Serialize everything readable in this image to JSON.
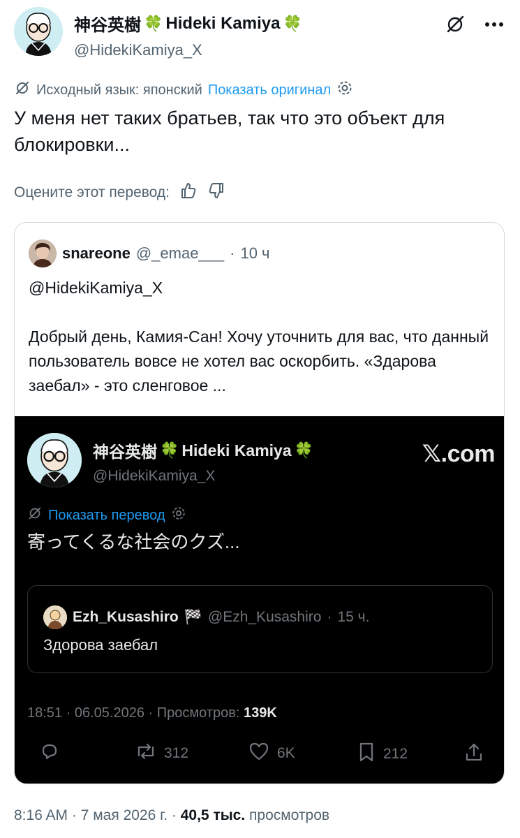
{
  "post": {
    "author_name": "神谷英樹",
    "author_name_latin": "Hideki Kamiya",
    "emoji": "🍀",
    "handle": "@HidekiKamiya_X",
    "translation_bar": {
      "source_lang": "Исходный язык: японский",
      "show_original": "Показать оригинал"
    },
    "text": "У меня нет таких братьев, так что это объект для блокировки...",
    "rate_label": "Оцените этот перевод:",
    "footer": {
      "time": "8:16 AM",
      "date": "7 мая 2026 г.",
      "views": "40,5 тыс.",
      "views_label": "просмотров"
    }
  },
  "quote": {
    "author_name": "snareone",
    "handle": "@_emae___",
    "age": "10 ч",
    "text": "@HidekiKamiya_X\n\nДобрый день, Камия-Сан! Хочу уточнить для вас, что данный пользователь вовсе не хотел вас оскорбить. «Здарова заебал» - это сленговое ..."
  },
  "screenshot": {
    "author_name": "神谷英樹",
    "author_name_latin": "Hideki Kamiya",
    "emoji": "🍀",
    "handle": "@HidekiKamiya_X",
    "brand": "𝕏.com",
    "show_translation": "Показать перевод",
    "text": "寄ってくるな社会のクズ...",
    "inner": {
      "author_name": "Ezh_Kusashiro",
      "flag": "🏁",
      "handle": "@Ezh_Kusashiro",
      "age": "15 ч.",
      "text": "Здорова заебал"
    },
    "stamp": {
      "time": "18:51",
      "date": "06.05.2026",
      "views_label": "Просмотров:",
      "views": "139K"
    },
    "actions": {
      "retweets": "312",
      "likes": "6K",
      "bookmarks": "212"
    }
  },
  "colors": {
    "accent": "#1d9bf0",
    "secondary_text": "#536471",
    "dark_bg": "#000000"
  }
}
